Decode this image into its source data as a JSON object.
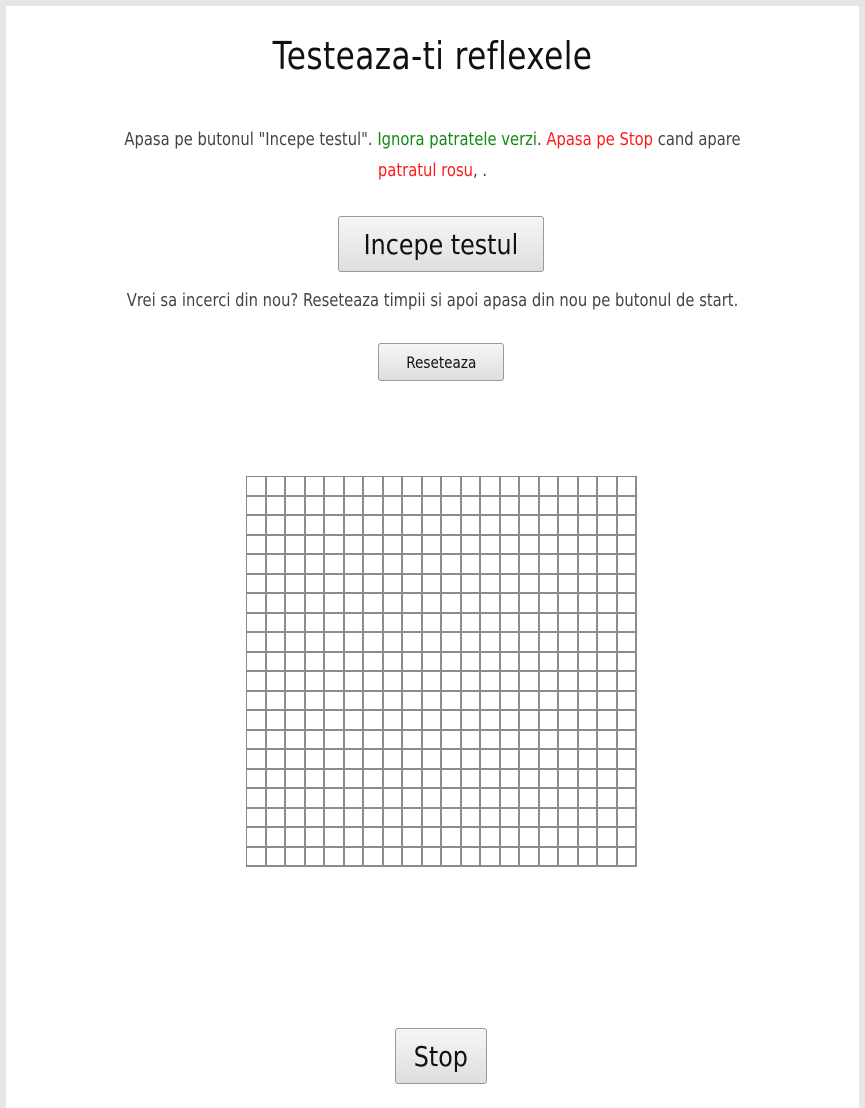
{
  "page": {
    "title": "Testeaza-ti reflexele"
  },
  "instructions": {
    "part1": "Apasa pe butonul \"Incepe testul\". ",
    "green_text": "Ignora patratele verzi",
    "part2": ". ",
    "red_text1": "Apasa pe Stop",
    "part3": " cand apare ",
    "red_text2": "patratul rosu",
    "part4": ", ."
  },
  "buttons": {
    "start_label": "Incepe testul",
    "reset_label": "Reseteaza",
    "stop_label": "Stop"
  },
  "retry": {
    "text": "Vrei sa incerci din nou? Reseteaza timpii si apoi apasa din nou pe butonul de start."
  },
  "grid": {
    "rows": 20,
    "columns": 20
  },
  "colors": {
    "green_text": "#138a13",
    "red_text": "#ff1a1a",
    "grid_lines": "#8c8c8c"
  }
}
